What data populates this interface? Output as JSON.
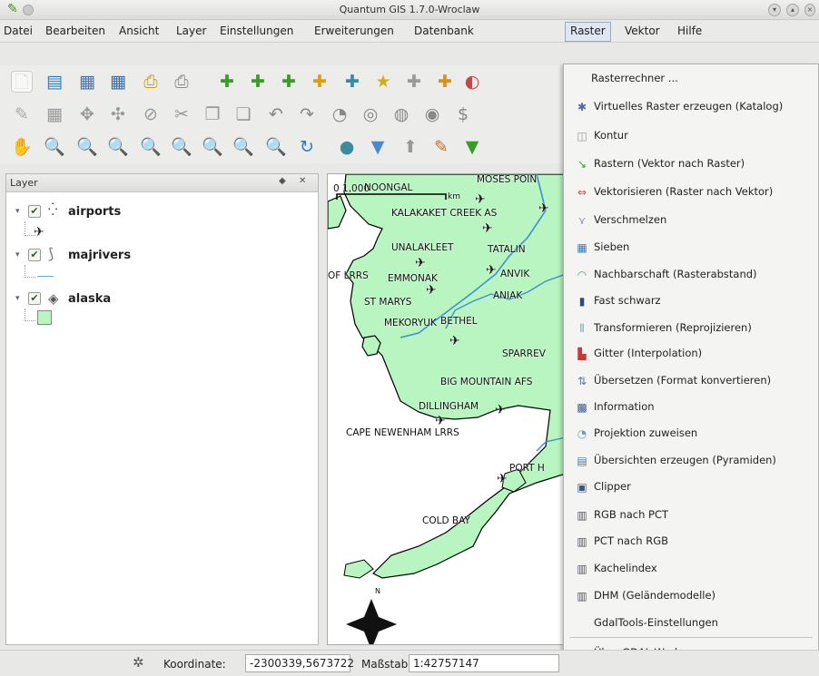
{
  "window": {
    "title": "Quantum GIS 1.7.0-Wroclaw"
  },
  "menubar": {
    "items": [
      "Datei",
      "Bearbeiten",
      "Ansicht",
      "Layer",
      "Einstellungen",
      "Erweiterungen",
      "Datenbank",
      "Raster",
      "Vektor",
      "Hilfe"
    ],
    "active": "Raster"
  },
  "layer_panel": {
    "title": "Layer",
    "layers": [
      {
        "name": "airports",
        "checked": true,
        "icon": "airport-icon"
      },
      {
        "name": "majrivers",
        "checked": true,
        "icon": "river-icon"
      },
      {
        "name": "alaska",
        "checked": true,
        "icon": "polygon-icon"
      }
    ]
  },
  "map": {
    "scale_bar_label": "0 1,000",
    "scale_bar_unit": "km",
    "labels": [
      "NOONGAL",
      "MOSES POIN",
      "KALAKAKET CREEK AS",
      "UNALAKLEET",
      "TATALIN",
      "OF LRRS",
      "EMMONAK",
      "ANVIK",
      "ST MARYS",
      "ANIAK",
      "MEKORYUK",
      "BETHEL",
      "SPARREV",
      "BIG MOUNTAIN AFS",
      "DILLINGHAM",
      "CAPE NEWENHAM LRRS",
      "PORT H",
      "COLD BAY"
    ]
  },
  "raster_menu": {
    "items": [
      {
        "label": "Rasterrechner ...",
        "icon": ""
      },
      {
        "label": "Virtuelles Raster erzeugen (Katalog)",
        "icon": "virtual-raster-icon"
      },
      {
        "label": "Kontur",
        "icon": "contour-icon"
      },
      {
        "label": "Rastern (Vektor nach Raster)",
        "icon": "rasterize-icon"
      },
      {
        "label": "Vektorisieren (Raster nach Vektor)",
        "icon": "polygonize-icon"
      },
      {
        "label": "Verschmelzen",
        "icon": "merge-icon"
      },
      {
        "label": "Sieben",
        "icon": "sieve-icon"
      },
      {
        "label": "Nachbarschaft (Rasterabstand)",
        "icon": "proximity-icon"
      },
      {
        "label": "Fast schwarz",
        "icon": "nearblack-icon"
      },
      {
        "label": "Transformieren (Reprojizieren)",
        "icon": "warp-icon"
      },
      {
        "label": "Gitter (Interpolation)",
        "icon": "grid-icon"
      },
      {
        "label": "Übersetzen (Format konvertieren)",
        "icon": "translate-icon"
      },
      {
        "label": "Information",
        "icon": "info-icon"
      },
      {
        "label": "Projektion zuweisen",
        "icon": "projection-icon"
      },
      {
        "label": "Übersichten erzeugen (Pyramiden)",
        "icon": "overview-icon"
      },
      {
        "label": "Clipper",
        "icon": "clipper-icon"
      },
      {
        "label": "RGB nach PCT",
        "icon": "rgb-pct-icon"
      },
      {
        "label": "PCT nach RGB",
        "icon": "pct-rgb-icon"
      },
      {
        "label": "Kachelindex",
        "icon": "tileindex-icon"
      },
      {
        "label": "DHM (Geländemodelle)",
        "icon": "dem-icon"
      },
      {
        "label": "GdalTools-Einstellungen",
        "icon": ""
      },
      {
        "label": "Über GDAL-Werkzeuge",
        "icon": "about-icon"
      }
    ]
  },
  "statusbar": {
    "coord_label": "Koordinate:",
    "coord_value": "-2300339,5673722",
    "scale_label": "Maßstab",
    "scale_value": "1:42757147"
  },
  "colors": {
    "land": "#b8f5c0",
    "river": "#3e8fd8",
    "menu_bg": "#f4f4f2",
    "active_menu": "#dfe6f0"
  }
}
